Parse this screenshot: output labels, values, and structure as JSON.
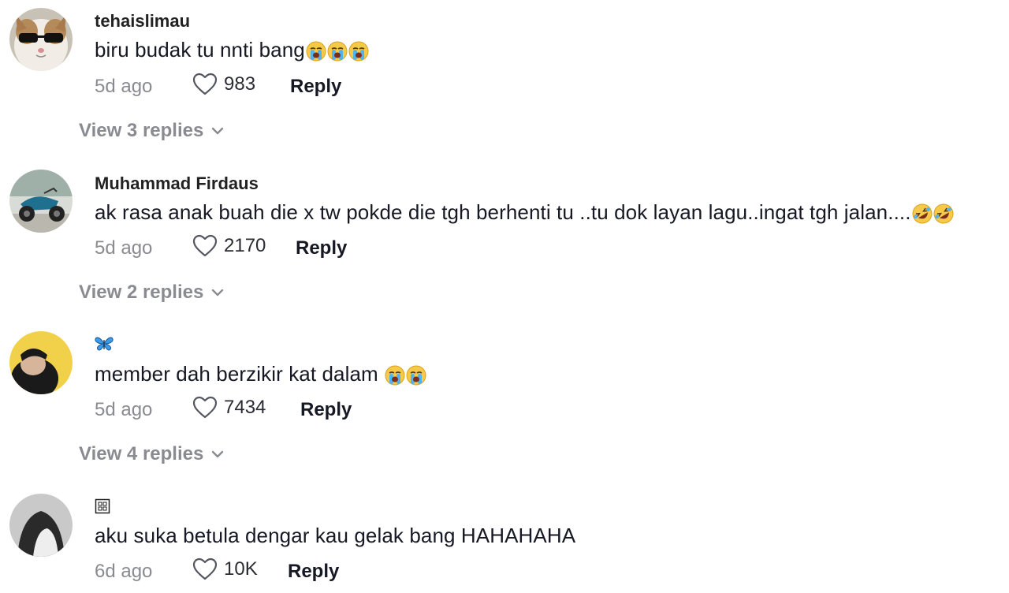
{
  "comments": [
    {
      "username": "tehaislimau",
      "text": "biru budak tu nnti bang",
      "text_emojis": [
        "loudly-crying-face",
        "loudly-crying-face",
        "loudly-crying-face"
      ],
      "time": "5d ago",
      "likes": "983",
      "reply_label": "Reply",
      "view_replies": "View 3 replies"
    },
    {
      "username": "Muhammad Firdaus",
      "text": "ak rasa anak buah die x tw pokde die tgh berhenti tu ..tu dok layan lagu..ingat tgh jalan....",
      "text_emojis": [
        "rolling-on-floor-laughing-face",
        "rolling-on-floor-laughing-face"
      ],
      "time": "5d ago",
      "likes": "2170",
      "reply_label": "Reply",
      "view_replies": "View 2 replies"
    },
    {
      "username": "",
      "username_emoji": "blue-butterfly",
      "text": "member dah berzikir kat dalam ",
      "text_emojis": [
        "loudly-crying-face",
        "loudly-crying-face"
      ],
      "time": "5d ago",
      "likes": "7434",
      "reply_label": "Reply",
      "view_replies": "View 4 replies"
    },
    {
      "username": "",
      "username_emoji": "missing-glyph-box",
      "text": "aku suka betula dengar kau gelak bang HAHAHAHA",
      "text_emojis": [],
      "time": "6d ago",
      "likes": "10K",
      "reply_label": "Reply"
    }
  ],
  "colors": {
    "text_primary": "#161823",
    "text_secondary": "#8a8b91",
    "background": "#ffffff"
  }
}
